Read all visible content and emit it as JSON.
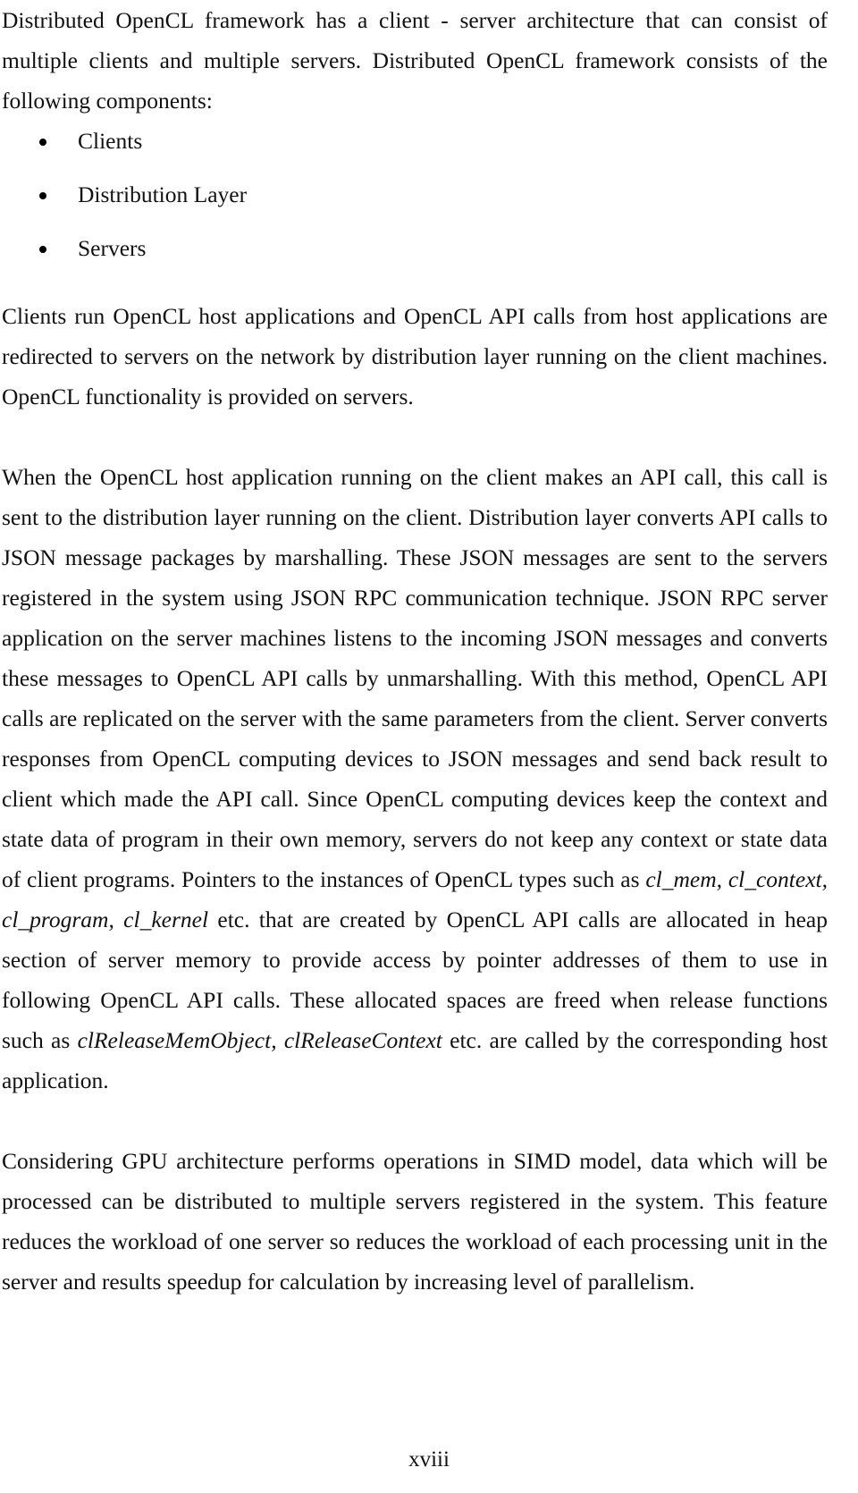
{
  "document": {
    "page_number": "xviii",
    "paragraphs": {
      "intro": "Distributed OpenCL framework has a client - server architecture that can consist of multiple clients and multiple servers. Distributed OpenCL framework consists of the following components:",
      "clients_servers": "Clients run OpenCL host applications and OpenCL API calls from host applications are redirected to servers on the network by distribution layer running on the client machines. OpenCL functionality is provided on servers.",
      "flow_part1": "When the OpenCL host application running on the client makes an API call, this call is sent to the distribution layer running on the client. Distribution layer converts API calls to JSON message packages by marshalling. These JSON messages are sent to the servers registered in the system using JSON RPC communication technique. JSON RPC server application on the server machines listens to the incoming JSON messages and converts these messages to OpenCL API calls by unmarshalling. With this method, OpenCL API calls are replicated on the server with the same parameters from the client. Server converts responses from OpenCL computing devices to JSON messages and send back result to client which made the API call. Since OpenCL computing devices keep the context and state data of program in their own memory, servers do not keep any context or state data of client programs. Pointers to the instances of OpenCL types such as ",
      "flow_types": "cl_mem, cl_context, cl_program, cl_kernel",
      "flow_part2": " etc. that are created by OpenCL API calls are allocated in heap section of server memory to provide access by pointer addresses of them to use in following OpenCL API calls. These allocated spaces are freed when release functions such as ",
      "flow_release_fns": "clReleaseMemObject, clReleaseContext",
      "flow_part3": " etc. are called by the corresponding host application.",
      "gpu_simd": "Considering GPU architecture performs operations in SIMD model, data which will be processed can be distributed to multiple servers registered in the system. This feature reduces the workload of one server so reduces the workload of each processing unit in the server and results speedup for calculation by increasing level of parallelism."
    },
    "bullet_list": {
      "items": [
        {
          "label": "Clients"
        },
        {
          "label": "Distribution Layer"
        },
        {
          "label": "Servers"
        }
      ]
    }
  }
}
